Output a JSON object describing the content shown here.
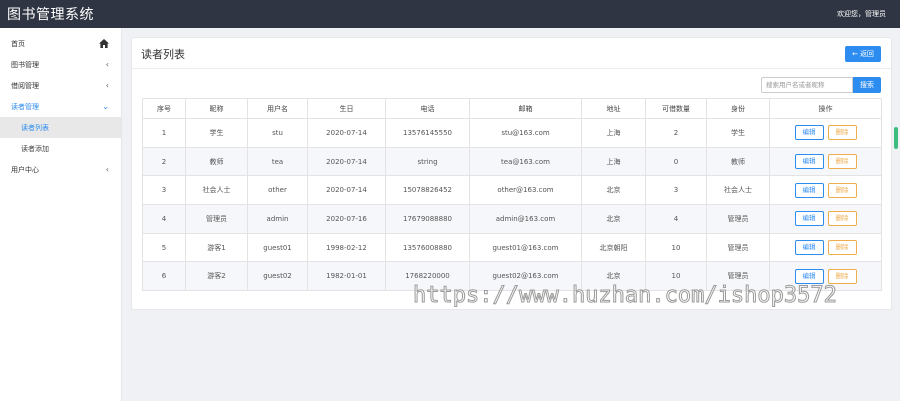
{
  "header": {
    "title": "图书管理系统",
    "welcome": "欢迎您，管理员"
  },
  "sidebar": {
    "items": [
      {
        "label": "首页",
        "icon": "home-icon"
      },
      {
        "label": "图书管理",
        "icon": "chevron-left-icon"
      },
      {
        "label": "借阅管理",
        "icon": "chevron-left-icon"
      },
      {
        "label": "读者管理",
        "icon": "chevron-down-icon",
        "active": true,
        "children": [
          {
            "label": "读者列表",
            "active": true
          },
          {
            "label": "读者添加"
          }
        ]
      },
      {
        "label": "用户中心",
        "icon": "chevron-left-icon"
      }
    ]
  },
  "main": {
    "title": "读者列表",
    "back_label": "返回",
    "back_icon": "arrow-left-icon",
    "search": {
      "placeholder": "搜索用户名或者昵称",
      "value": "",
      "button": "搜索"
    },
    "table": {
      "columns": [
        "序号",
        "昵称",
        "用户名",
        "生日",
        "电话",
        "邮箱",
        "地址",
        "可借数量",
        "身份",
        "操作"
      ],
      "edit_label": "编辑",
      "delete_label": "删除",
      "rows": [
        [
          "1",
          "学生",
          "stu",
          "2020-07-14",
          "13576145550",
          "stu@163.com",
          "上海",
          "2",
          "学生"
        ],
        [
          "2",
          "教师",
          "tea",
          "2020-07-14",
          "string",
          "tea@163.com",
          "上海",
          "0",
          "教师"
        ],
        [
          "3",
          "社会人士",
          "other",
          "2020-07-14",
          "15078826452",
          "other@163.com",
          "北京",
          "3",
          "社会人士"
        ],
        [
          "4",
          "管理员",
          "admin",
          "2020-07-16",
          "17679088880",
          "admin@163.com",
          "北京",
          "4",
          "管理员"
        ],
        [
          "5",
          "游客1",
          "guest01",
          "1998-02-12",
          "13576008880",
          "guest01@163.com",
          "北京朝阳",
          "10",
          "管理员"
        ],
        [
          "6",
          "游客2",
          "guest02",
          "1982-01-01",
          "1768220000",
          "guest02@163.com",
          "北京",
          "10",
          "管理员"
        ]
      ]
    }
  },
  "watermark": "https://www.huzhan.com/ishop3572",
  "colors": {
    "topbar": "#2f3542",
    "primary": "#2d8cf0",
    "warning": "#f0ad4e",
    "scroll": "#3dbd7d"
  }
}
